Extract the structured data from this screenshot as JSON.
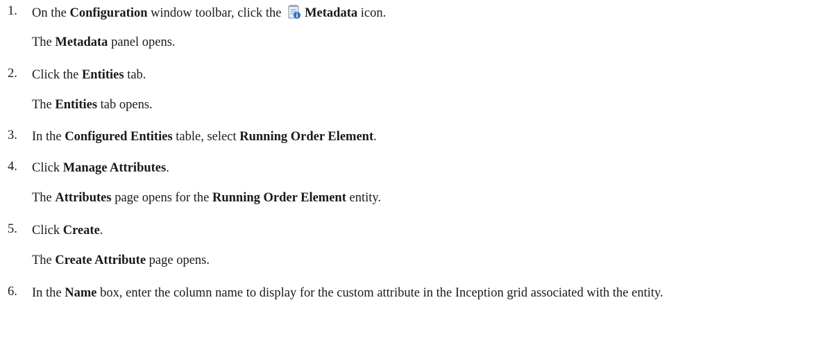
{
  "steps": [
    {
      "number": "1.",
      "parts": {
        "a": "On the ",
        "b": "Configuration",
        "c": " window toolbar, click the ",
        "d": "Metadata",
        "e": " icon."
      },
      "result": {
        "a": "The ",
        "b": "Metadata",
        "c": " panel opens."
      }
    },
    {
      "number": "2.",
      "parts": {
        "a": "Click the ",
        "b": "Entities",
        "c": " tab."
      },
      "result": {
        "a": "The ",
        "b": "Entities",
        "c": " tab opens."
      }
    },
    {
      "number": "3.",
      "parts": {
        "a": "In the ",
        "b": "Configured Entities",
        "c": " table, select ",
        "d": "Running Order Element",
        "e": "."
      }
    },
    {
      "number": "4.",
      "parts": {
        "a": "Click ",
        "b": "Manage Attributes",
        "c": "."
      },
      "result": {
        "a": "The ",
        "b": "Attributes",
        "c": " page opens for the ",
        "d": "Running Order Element",
        "e": " entity."
      }
    },
    {
      "number": "5.",
      "parts": {
        "a": "Click ",
        "b": "Create",
        "c": "."
      },
      "result": {
        "a": "The ",
        "b": "Create Attribute",
        "c": " page opens."
      }
    },
    {
      "number": "6.",
      "parts": {
        "a": "In the ",
        "b": "Name",
        "c": " box, enter the column name to display for the custom attribute in the Inception grid associated with the entity."
      }
    }
  ],
  "icons": {
    "metadata": "metadata-icon"
  },
  "colors": {
    "icon_page": "#e8eef6",
    "icon_info": "#2f6fc0"
  }
}
